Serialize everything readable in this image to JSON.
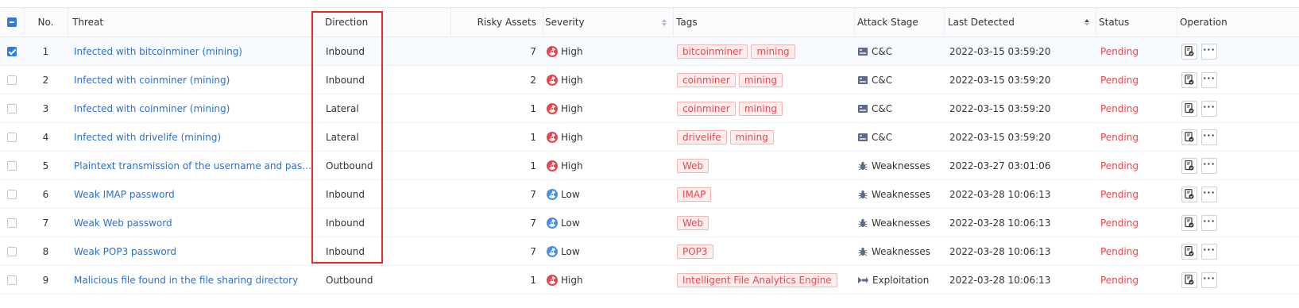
{
  "columns": {
    "no": "No.",
    "threat": "Threat",
    "direction": "Direction",
    "risky_assets": "Risky Assets",
    "severity": "Severity",
    "tags": "Tags",
    "attack_stage": "Attack Stage",
    "last_detected": "Last Detected",
    "status": "Status",
    "operation": "Operation"
  },
  "rows": [
    {
      "no": "1",
      "threat": "Infected with bitcoinminer (mining)",
      "direction": "Inbound",
      "risky_assets": "7",
      "severity": "High",
      "tags": [
        "bitcoinminer",
        "mining"
      ],
      "attack_stage": "C&C",
      "last_detected": "2022-03-15 03:59:20",
      "status": "Pending",
      "checked": true
    },
    {
      "no": "2",
      "threat": "Infected with coinminer (mining)",
      "direction": "Inbound",
      "risky_assets": "2",
      "severity": "High",
      "tags": [
        "coinminer",
        "mining"
      ],
      "attack_stage": "C&C",
      "last_detected": "2022-03-15 03:59:20",
      "status": "Pending",
      "checked": false
    },
    {
      "no": "3",
      "threat": "Infected with coinminer (mining)",
      "direction": "Lateral",
      "risky_assets": "1",
      "severity": "High",
      "tags": [
        "coinminer",
        "mining"
      ],
      "attack_stage": "C&C",
      "last_detected": "2022-03-15 03:59:20",
      "status": "Pending",
      "checked": false
    },
    {
      "no": "4",
      "threat": "Infected with drivelife (mining)",
      "direction": "Lateral",
      "risky_assets": "1",
      "severity": "High",
      "tags": [
        "drivelife",
        "mining"
      ],
      "attack_stage": "C&C",
      "last_detected": "2022-03-15 03:59:20",
      "status": "Pending",
      "checked": false
    },
    {
      "no": "5",
      "threat": "Plaintext transmission of the username and password for...",
      "direction": "Outbound",
      "risky_assets": "1",
      "severity": "High",
      "tags": [
        "Web"
      ],
      "attack_stage": "Weaknesses",
      "last_detected": "2022-03-27 03:01:06",
      "status": "Pending",
      "checked": false
    },
    {
      "no": "6",
      "threat": "Weak IMAP password",
      "direction": "Inbound",
      "risky_assets": "7",
      "severity": "Low",
      "tags": [
        "IMAP"
      ],
      "attack_stage": "Weaknesses",
      "last_detected": "2022-03-28 10:06:13",
      "status": "Pending",
      "checked": false
    },
    {
      "no": "7",
      "threat": "Weak Web password",
      "direction": "Inbound",
      "risky_assets": "7",
      "severity": "Low",
      "tags": [
        "Web"
      ],
      "attack_stage": "Weaknesses",
      "last_detected": "2022-03-28 10:06:13",
      "status": "Pending",
      "checked": false
    },
    {
      "no": "8",
      "threat": "Weak POP3 password",
      "direction": "Inbound",
      "risky_assets": "7",
      "severity": "Low",
      "tags": [
        "POP3"
      ],
      "attack_stage": "Weaknesses",
      "last_detected": "2022-03-28 10:06:13",
      "status": "Pending",
      "checked": false
    },
    {
      "no": "9",
      "threat": "Malicious file found in the file sharing directory",
      "direction": "Outbound",
      "risky_assets": "1",
      "severity": "High",
      "tags": [
        "Intelligent File Analytics Engine"
      ],
      "attack_stage": "Exploitation",
      "last_detected": "2022-03-28 10:06:13",
      "status": "Pending",
      "checked": false
    }
  ],
  "colors": {
    "link": "#2f6fc3",
    "high": "#e5454c",
    "low": "#4a8fe0",
    "pending": "#e5454c",
    "highlight": "#e52b2b",
    "accent": "#2f7ae5"
  },
  "icons": {
    "high": "radiation-high-icon",
    "low": "radiation-low-icon",
    "cc": "server-icon",
    "weaknesses": "bug-icon",
    "exploitation": "arrow-exploit-icon",
    "handle": "handle-ticket-icon",
    "more": "more-dots-icon"
  }
}
